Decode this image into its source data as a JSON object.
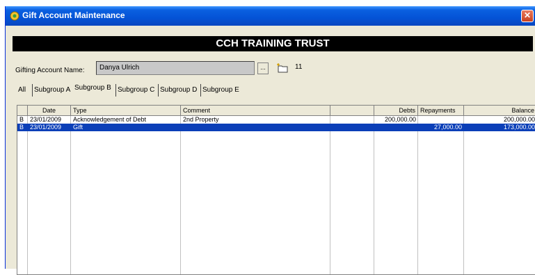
{
  "window": {
    "title": "Gift Account Maintenance",
    "close_glyph": "✕"
  },
  "banner": {
    "text": "CCH TRAINING TRUST"
  },
  "account": {
    "label": "Gifting Account Name:",
    "value": "Danya Ulrich",
    "browse_glyph": "...",
    "count": "11"
  },
  "tabs": [
    {
      "label": "All"
    },
    {
      "label": "Subgroup A"
    },
    {
      "label": "Subgroup B",
      "active": true
    },
    {
      "label": "Subgroup C"
    },
    {
      "label": "Subgroup D"
    },
    {
      "label": "Subgroup E"
    }
  ],
  "grid": {
    "columns": [
      "",
      "Date",
      "Type",
      "Comment",
      "",
      "Debts",
      "Repayments",
      "Balance"
    ],
    "rows": [
      {
        "flag": "B",
        "date": "23/01/2009",
        "type": "Acknowledgement of Debt",
        "comment": "2nd Property",
        "extra": "",
        "debts": "200,000.00",
        "repayments": "",
        "balance": "200,000.00",
        "selected": false
      },
      {
        "flag": "B",
        "date": "23/01/2009",
        "type": "Gift",
        "comment": "",
        "extra": "",
        "debts": "",
        "repayments": "27,000.00",
        "balance": "173,000.00",
        "selected": true
      }
    ]
  },
  "colors": {
    "titlebar": "#0453d6",
    "selection": "#0b3fb8",
    "banner": "#000000"
  },
  "icons": {
    "title": "app-gear-icon",
    "close": "close-icon",
    "browse": "ellipsis-icon",
    "new": "new-folder-icon"
  }
}
